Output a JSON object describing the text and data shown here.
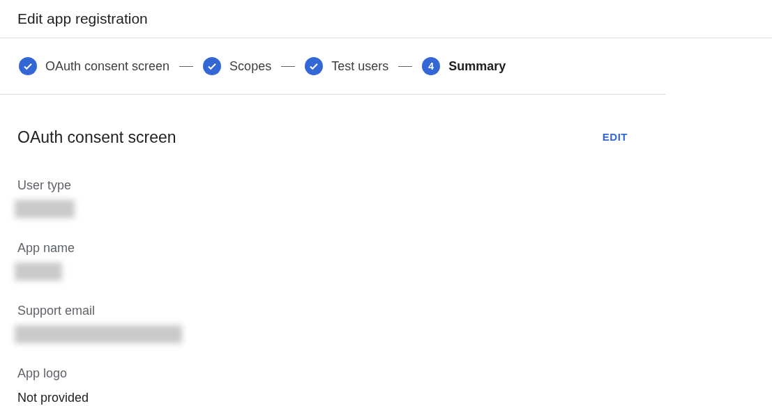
{
  "header": {
    "title": "Edit app registration"
  },
  "steps": [
    {
      "label": "OAuth consent screen",
      "completed": true,
      "selected": false
    },
    {
      "label": "Scopes",
      "completed": true,
      "selected": false
    },
    {
      "label": "Test users",
      "completed": true,
      "selected": false
    },
    {
      "label": "Summary",
      "number": "4",
      "completed": false,
      "selected": true
    }
  ],
  "section": {
    "title": "OAuth consent screen",
    "action": "EDIT"
  },
  "fields": [
    {
      "label": "User type",
      "redacted": true
    },
    {
      "label": "App name",
      "redacted": true
    },
    {
      "label": "Support email",
      "redacted": true
    },
    {
      "label": "App logo",
      "value": "Not provided",
      "redacted": false
    }
  ]
}
